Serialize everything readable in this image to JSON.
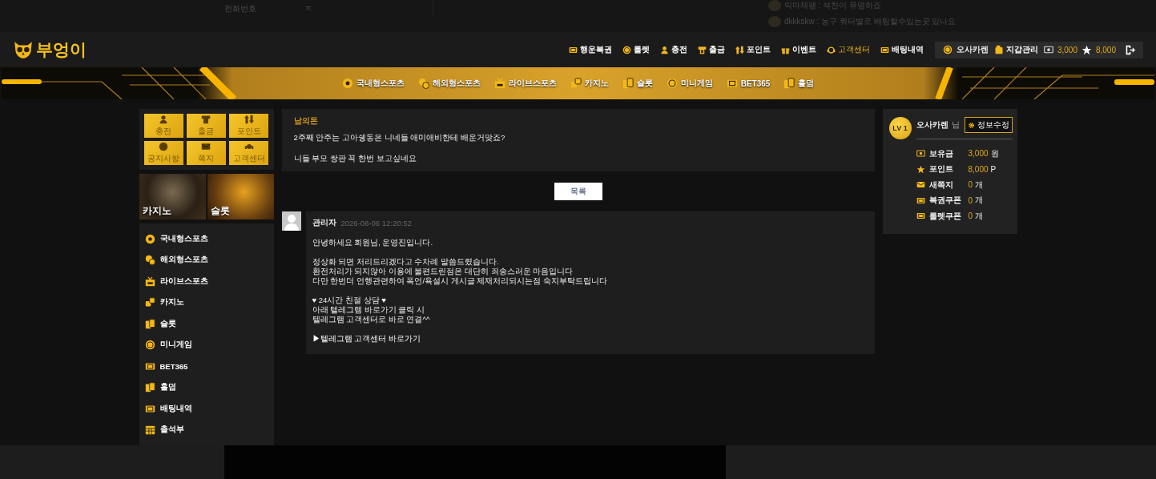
{
  "top_strip": {
    "field_label": "전화번호",
    "field_value": "ㅈ"
  },
  "chat": [
    "익마재팽 : 석천이 뮤명하죠",
    "dkkkskw : 농구 쿼터별로 배팅할수있는곳 있나요"
  ],
  "logo": "부엉이",
  "top_menu": [
    {
      "label": "행운복권",
      "selected": false
    },
    {
      "label": "룰렛",
      "selected": false
    },
    {
      "label": "충전",
      "selected": false
    },
    {
      "label": "출금",
      "selected": false
    },
    {
      "label": "포인트",
      "selected": false
    },
    {
      "label": "이벤트",
      "selected": false
    },
    {
      "label": "고객센터",
      "selected": true
    },
    {
      "label": "배팅내역",
      "selected": false
    }
  ],
  "user_bar": {
    "name": "오사카렌",
    "wallet": "지갑관리",
    "money": "3,000",
    "points": "8,000"
  },
  "game_nav": [
    "국내형스포츠",
    "해외형스포츠",
    "라이브스포츠",
    "카지노",
    "슬롯",
    "미니게임",
    "BET365",
    "홀덤"
  ],
  "quick_buttons": [
    "충전",
    "출금",
    "포인트",
    "공지사항",
    "쪽지",
    "고객센터"
  ],
  "promo_tiles": [
    "카지노",
    "슬롯"
  ],
  "side_menu": [
    "국내형스포츠",
    "해외형스포츠",
    "라이브스포츠",
    "카지노",
    "슬롯",
    "미니게임",
    "BET365",
    "홀덤",
    "배팅내역",
    "출석부"
  ],
  "post": {
    "title": "남의돈",
    "lines": [
      "2주째 안주는 고아쉥동은 니네들 애미애비한테 배운거맞죠?",
      "니들 부모 쌍판 꼭 한번 보고싶네요"
    ]
  },
  "list_button": "목록",
  "comment": {
    "author": "관리자",
    "date": "2026-08-06 12:20:52",
    "paragraphs": [
      [
        "안녕하세요 회원님, 운영진입니다."
      ],
      [
        "정상화 되면 처리드리겠다고 수차례 말씀드렸습니다.",
        "환전처리가 되지않아 이용에 불편드린점은 대단히 죄송스러운 마음입니다",
        "다만 한번더 언행관련하여 폭언/욕설시 게시글 제재처리되시는점 숙지부탁드립니다"
      ],
      [
        "♥ 24시간 친절 상담 ♥",
        "아래 텔레그램 바로가기 클릭 시",
        "텔레그램 고객센터로 바로 연결^^"
      ]
    ],
    "link": "▶텔레그램 고객센터 바로가기"
  },
  "profile": {
    "level": "LV 1",
    "name": "오사카렌",
    "suffix": "님",
    "edit_button": "정보수정",
    "stats": [
      {
        "label": "보유금",
        "value": "3,000",
        "unit": "원"
      },
      {
        "label": "포인트",
        "value": "8,000",
        "unit": "P"
      },
      {
        "label": "새쪽지",
        "value": "0",
        "unit": "개"
      },
      {
        "label": "복권쿠폰",
        "value": "0",
        "unit": "개"
      },
      {
        "label": "룰렛쿠폰",
        "value": "0",
        "unit": "개"
      }
    ]
  }
}
